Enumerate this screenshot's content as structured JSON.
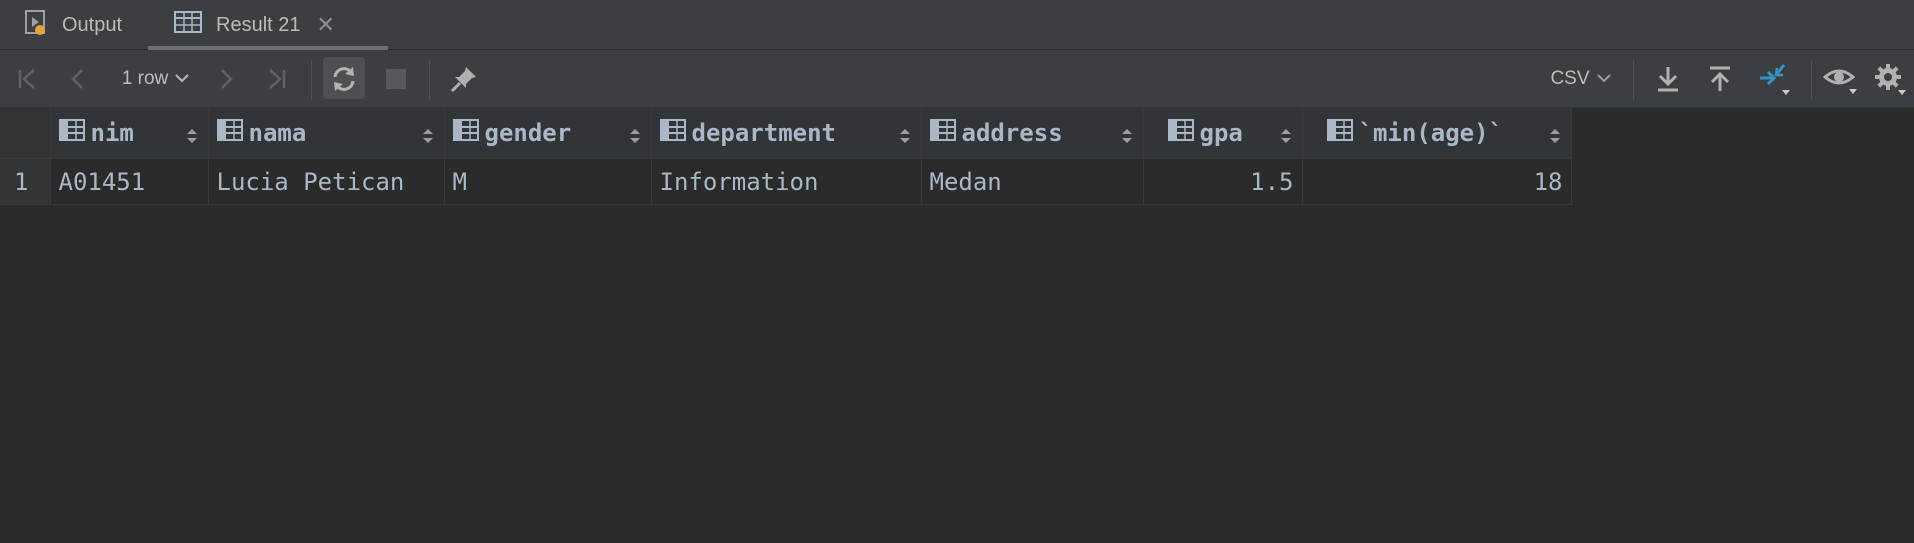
{
  "tabs": {
    "output_label": "Output",
    "result_label": "Result 21"
  },
  "toolbar": {
    "rows_label": "1 row",
    "export_format": "CSV"
  },
  "grid": {
    "columns": [
      "nim",
      "nama",
      "gender",
      "department",
      "address",
      "gpa",
      "`min(age)`"
    ],
    "rows": [
      {
        "row_number": "1",
        "nim": "A01451",
        "nama": "Lucia Petican",
        "gender": "M",
        "department": "Information",
        "address": "Medan",
        "gpa": "1.5",
        "min_age": "18"
      }
    ]
  },
  "colors": {
    "background": "#2b2b2b",
    "panel": "#3c3f41",
    "header": "#323537",
    "text": "#a9b7c6",
    "accent_blue": "#3592c4",
    "accent_orange": "#e8a33d"
  }
}
